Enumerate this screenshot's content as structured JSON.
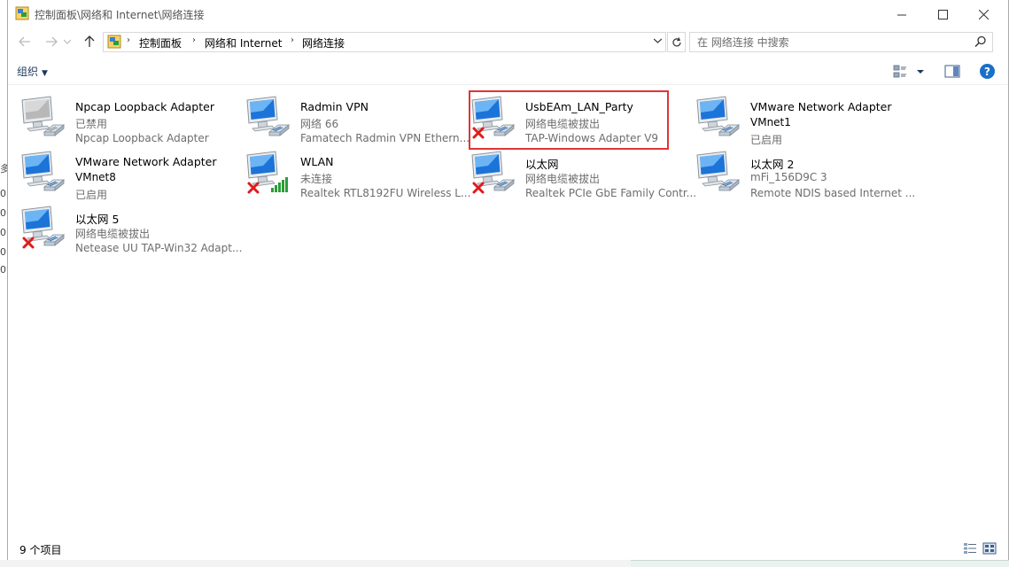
{
  "window": {
    "title": "控制面板\\网络和 Internet\\网络连接"
  },
  "address": {
    "crumbs": [
      "控制面板",
      "网络和 Internet",
      "网络连接"
    ]
  },
  "search": {
    "placeholder": "在 网络连接 中搜索"
  },
  "toolbar": {
    "organize_label": "组织"
  },
  "adapters": [
    {
      "name": "Npcap Loopback Adapter",
      "status": "已禁用",
      "device": "Npcap Loopback Adapter",
      "state": "disabled"
    },
    {
      "name": "Radmin VPN",
      "status": "网络 66",
      "device": "Famatech Radmin VPN Ethern...",
      "state": "connected"
    },
    {
      "name": "UsbEAm_LAN_Party",
      "status": "网络电缆被拔出",
      "device": "TAP-Windows Adapter V9",
      "state": "unplugged",
      "highlighted": true
    },
    {
      "name": "VMware Network Adapter",
      "status": "VMnet1",
      "device": "已启用",
      "state": "connected"
    },
    {
      "name": "VMware Network Adapter",
      "status": "VMnet8",
      "device": "已启用",
      "state": "connected"
    },
    {
      "name": "WLAN",
      "status": "未连接",
      "device": "Realtek RTL8192FU Wireless L...",
      "state": "wifi-disconnected"
    },
    {
      "name": "以太网",
      "status": "网络电缆被拔出",
      "device": "Realtek PCIe GbE Family Contr...",
      "state": "unplugged"
    },
    {
      "name": "以太网 2",
      "status": "mFi_156D9C 3",
      "device": "Remote NDIS based Internet ...",
      "state": "connected"
    },
    {
      "name": "以太网 5",
      "status": "网络电缆被拔出",
      "device": "Netease UU TAP-Win32 Adapt...",
      "state": "unplugged"
    }
  ],
  "statusbar": {
    "count": "9 个项目"
  },
  "colors": {
    "highlight": "#e03535",
    "link_blue": "#1e395b",
    "help_blue": "#1a6fc9"
  }
}
